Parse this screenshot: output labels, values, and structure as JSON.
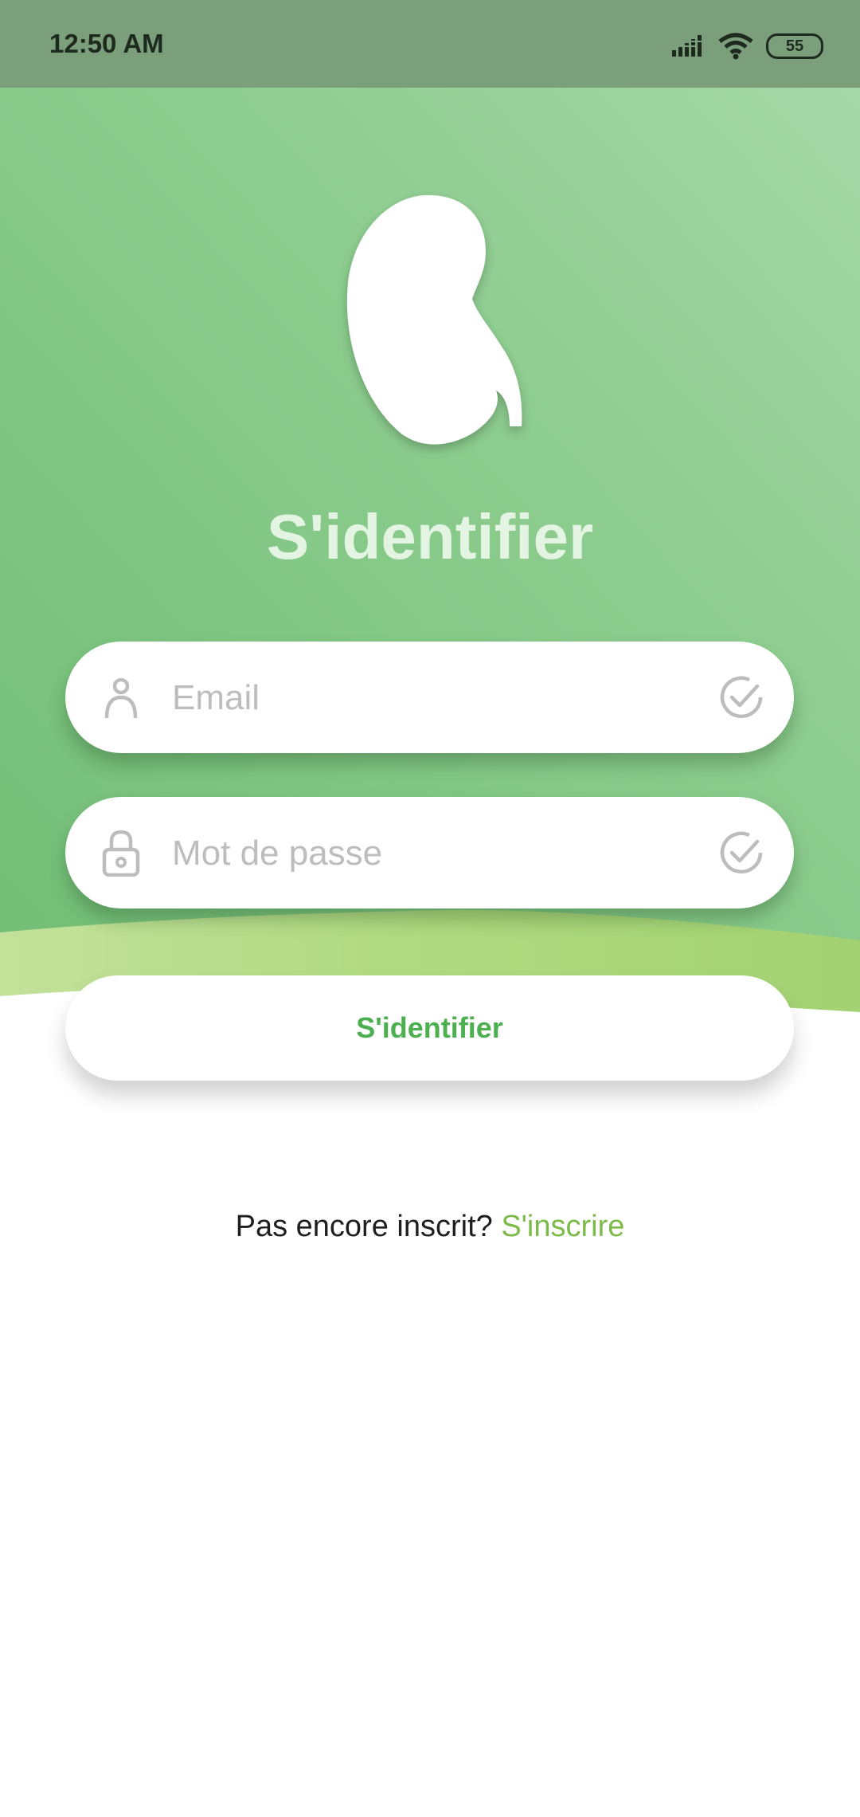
{
  "status_bar": {
    "time": "12:50 AM",
    "battery": "55",
    "icons": [
      "signal-icon",
      "wifi-icon",
      "battery-icon"
    ]
  },
  "login": {
    "title": "S'identifier",
    "email_placeholder": "Email",
    "email_value": "",
    "password_placeholder": "Mot de passe",
    "password_value": "",
    "submit_label": "S'identifier",
    "signup_prompt": "Pas encore inscrit?",
    "signup_link": "S'inscrire"
  },
  "colors": {
    "brand_green": "#4caf50",
    "link_green": "#7cba4a",
    "status_bar": "#7b9e7b",
    "placeholder": "#bdbdbd"
  }
}
